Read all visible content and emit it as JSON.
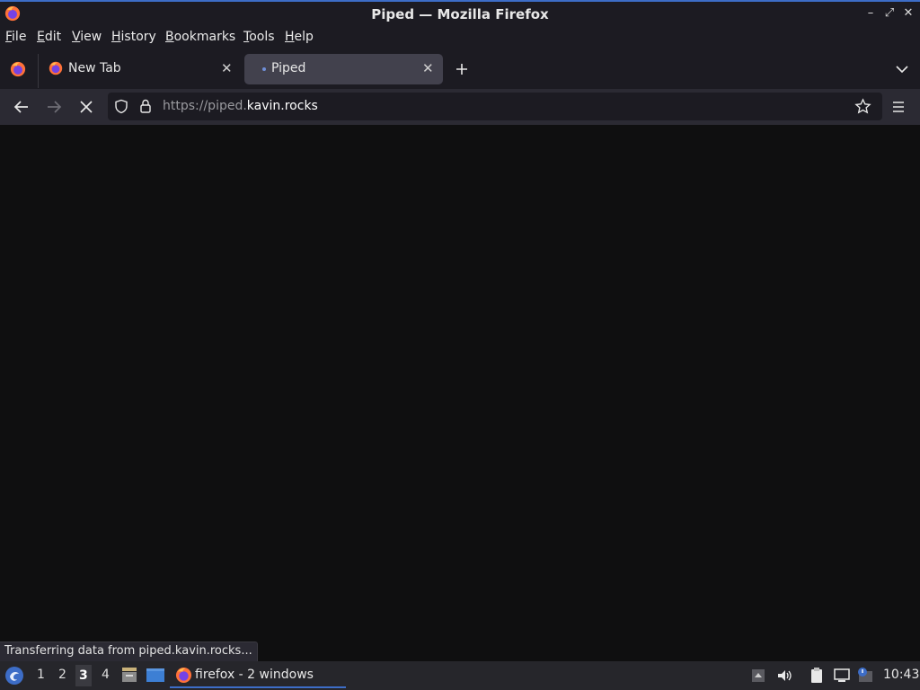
{
  "window": {
    "title": "Piped — Mozilla Firefox"
  },
  "menu": {
    "items": [
      {
        "label": "File"
      },
      {
        "label": "Edit"
      },
      {
        "label": "View"
      },
      {
        "label": "History"
      },
      {
        "label": "Bookmarks"
      },
      {
        "label": "Tools"
      },
      {
        "label": "Help"
      }
    ]
  },
  "tabs": [
    {
      "label": "New Tab",
      "active": false,
      "icon": "firefox-icon"
    },
    {
      "label": "Piped",
      "active": true,
      "icon": "loading-dot-icon"
    }
  ],
  "navigation": {
    "url_scheme": "https://piped.",
    "url_host": "kavin.rocks"
  },
  "status": {
    "text": "Transferring data from piped.kavin.rocks..."
  },
  "taskbar": {
    "workspaces": [
      "1",
      "2",
      "3",
      "4"
    ],
    "active_workspace": "3",
    "task_label": "firefox - 2 windows",
    "clock": "10:43"
  },
  "colors": {
    "accent": "#3d6dc7",
    "background": "#0f0f10",
    "toolbar": "#2b2a33",
    "titlebar": "#1c1b22"
  }
}
